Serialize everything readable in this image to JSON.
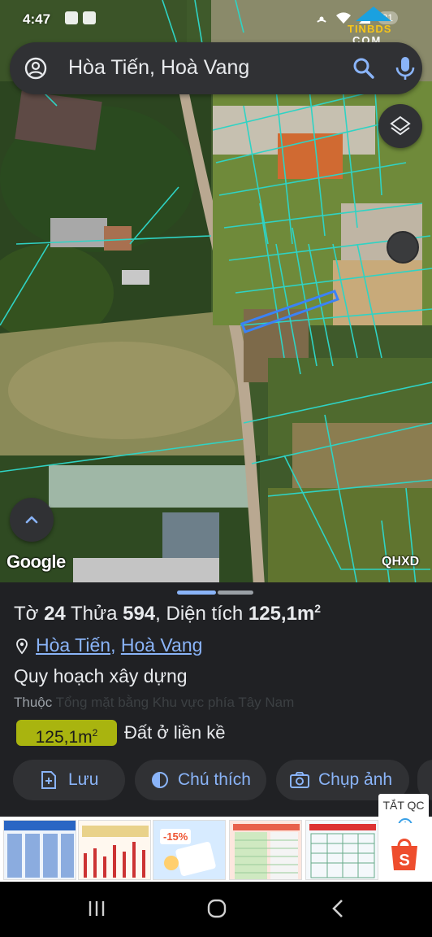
{
  "status_bar": {
    "time": "4:47",
    "battery": "31"
  },
  "watermark": {
    "line1": "TINBDS",
    "line2": "COM"
  },
  "search": {
    "query": "Hòa Tiến, Hoà Vang"
  },
  "map": {
    "attribution": "Google",
    "layer_label": "QHXD",
    "colors": {
      "parcel_outline": "#2fd3c4",
      "selected_parcel": "#3b82f6"
    }
  },
  "parcel": {
    "title_prefix": "Tờ",
    "sheet_no": "24",
    "lot_word": "Thửa",
    "lot_no": "594",
    "area_word": ", Diện tích",
    "area_value": "125,1m",
    "area_sup": "2",
    "address_links": [
      "Hòa Tiến",
      "Hoà Vang"
    ],
    "address_separator": ",",
    "plan_label": "Quy hoạch xây dựng",
    "belongs_label": "Thuộc",
    "belongs_value": "Tổng mặt bằng Khu vực phía Tây Nam",
    "chip_value": "125,1m",
    "chip_sup": "2",
    "land_type": "Đất ở liền kề",
    "chip_color": "#a9b40f"
  },
  "actions": {
    "save": "Lưu",
    "legend": "Chú thích",
    "photo": "Chụp ảnh"
  },
  "ad": {
    "close_label": "TẮT QC",
    "thumb_sale": "-15%"
  }
}
